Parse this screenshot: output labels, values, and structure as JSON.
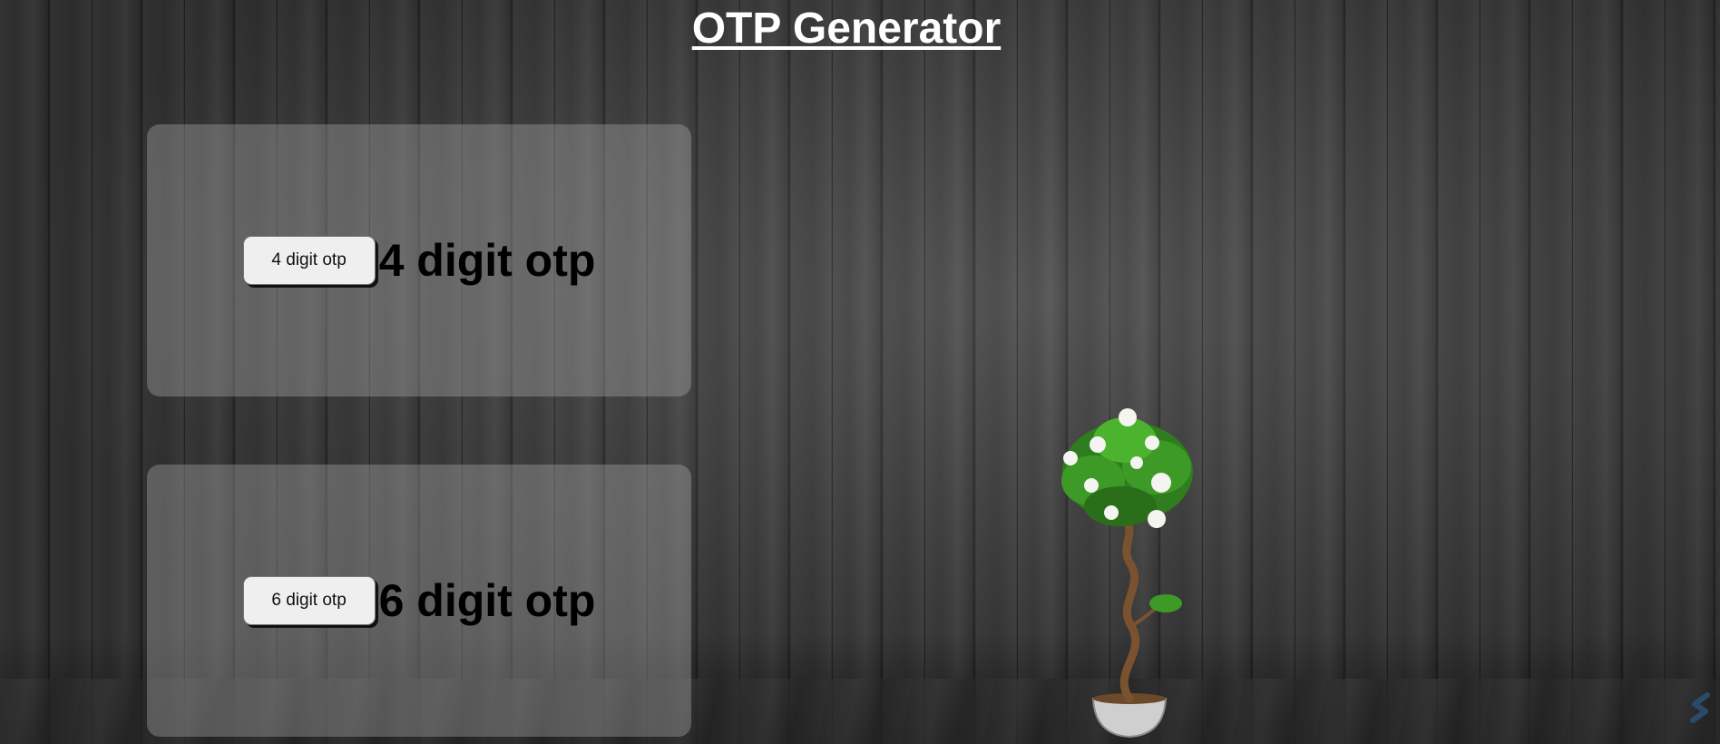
{
  "header": {
    "title": "OTP Generator"
  },
  "cards": [
    {
      "button_label": "4 digit otp",
      "output_text": "4 digit otp"
    },
    {
      "button_label": "6 digit otp",
      "output_text": "6 digit otp"
    }
  ],
  "decor": {
    "plant_icon": "rose-bonsai-plant",
    "corner_logo_icon": "s-logo",
    "colors": {
      "title": "#ffffff",
      "card_background": "rgba(170,170,170,0.38)",
      "button_background": "#efefef",
      "output_text": "#000000"
    }
  }
}
